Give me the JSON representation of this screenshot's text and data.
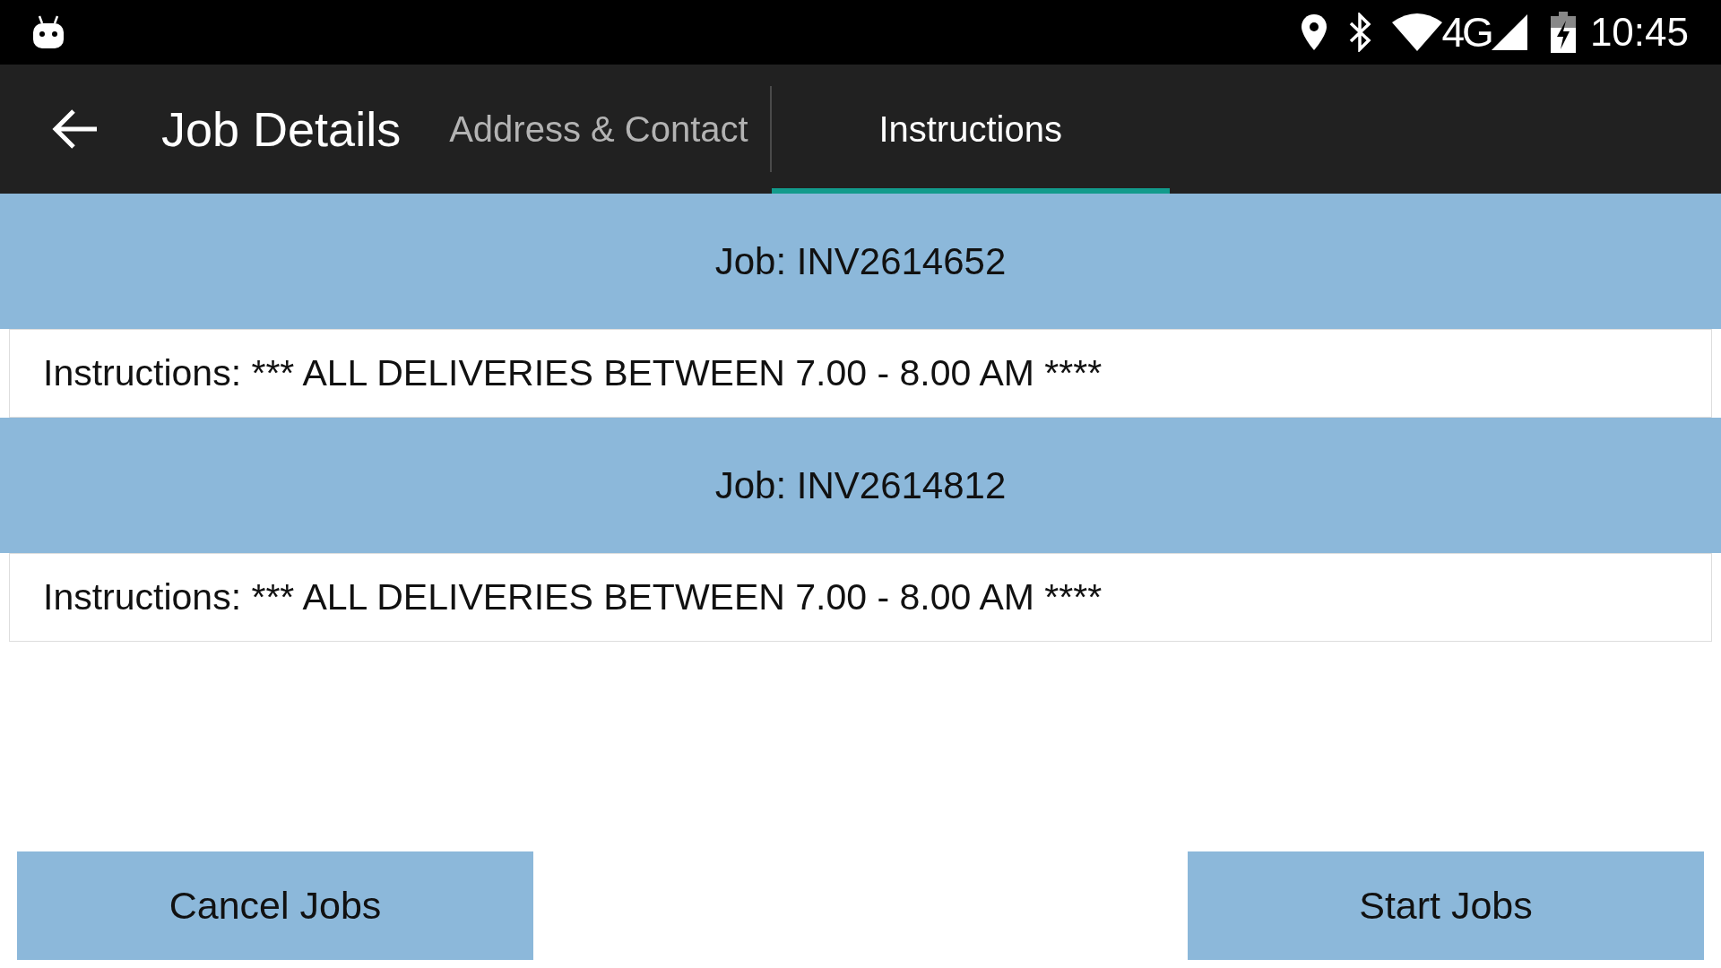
{
  "status_bar": {
    "network": "4G",
    "time": "10:45"
  },
  "app_bar": {
    "title": "Job Details"
  },
  "tabs": [
    {
      "label": "Address & Contact",
      "selected": false
    },
    {
      "label": "Instructions",
      "selected": true
    }
  ],
  "jobs": [
    {
      "title": "Job: INV2614652",
      "instructions": "Instructions: *** ALL DELIVERIES BETWEEN 7.00 - 8.00 AM ****"
    },
    {
      "title": "Job: INV2614812",
      "instructions": "Instructions: *** ALL DELIVERIES BETWEEN 7.00 - 8.00 AM ****"
    }
  ],
  "buttons": [
    "Cancel Jobs",
    "Start Jobs"
  ]
}
